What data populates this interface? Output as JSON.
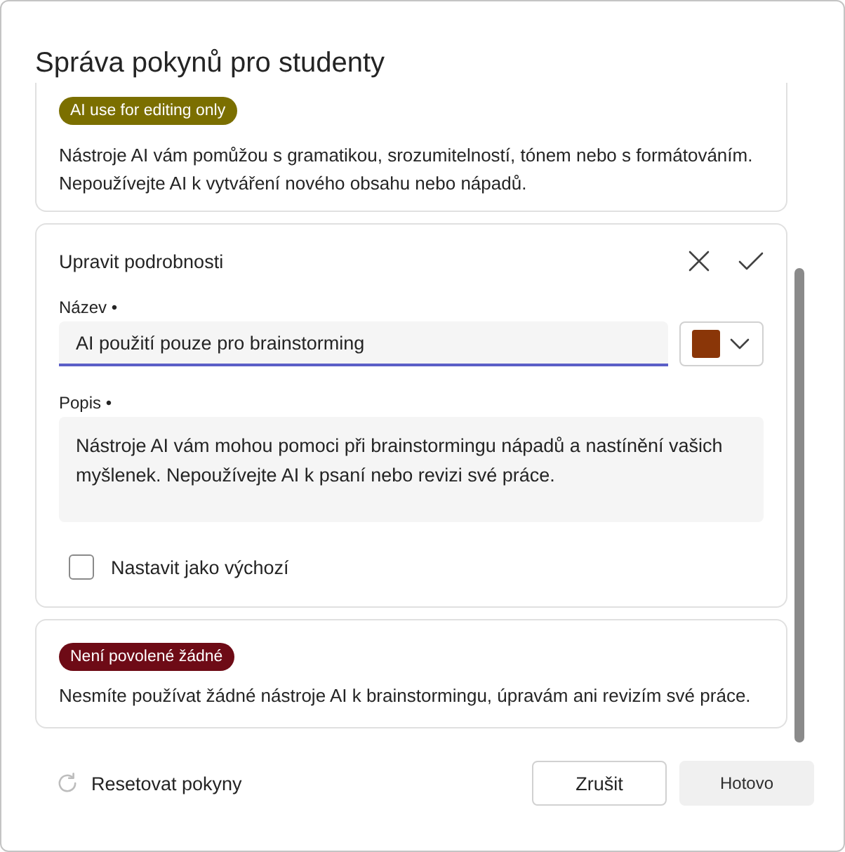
{
  "dialog": {
    "title": "Správa pokynů pro studenty"
  },
  "guidelines": [
    {
      "kind": "summary",
      "badge": "AI use for editing only",
      "color": "#7b6f00",
      "description": "Nástroje AI vám pomůžou s gramatikou, srozumitelností, tónem nebo s formátováním. Nepoužívejte AI k vytváření nového obsahu nebo nápadů."
    },
    {
      "kind": "editor",
      "heading": "Upravit podrobnosti",
      "name_field": {
        "label": "Název •",
        "value": "AI použití pouze pro brainstorming",
        "focused": true
      },
      "color_picker": {
        "color": "#8a3608"
      },
      "description_field": {
        "label": "Popis •",
        "value": "Nástroje AI vám mohou pomoci při brainstormingu nápadů a nastínění vašich myšlenek. Nepoužívejte AI k psaní nebo revizi své práce."
      },
      "default_checkbox": {
        "label": "Nastavit jako výchozí",
        "checked": false
      }
    },
    {
      "kind": "summary",
      "badge": "Není povolené žádné",
      "color": "#6e0b16",
      "description": "Nesmíte používat žádné nástroje AI k brainstormingu, úpravám ani revizím své práce."
    }
  ],
  "footer": {
    "reset": "Resetovat pokyny",
    "buttons": [
      {
        "label": "Zrušit",
        "disabled": false
      },
      {
        "label": "Hotovo",
        "disabled": true
      }
    ]
  }
}
